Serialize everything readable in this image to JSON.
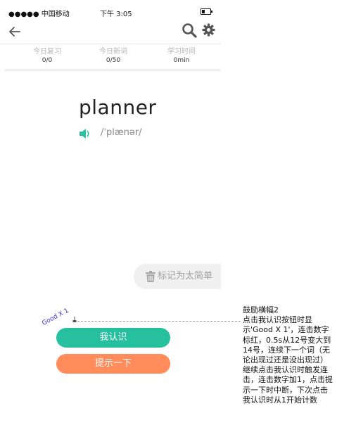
{
  "status_bar": {
    "carrier": "●●●●● 中国移动",
    "time": "下午 3:05"
  },
  "stats": [
    {
      "label": "今日复习",
      "value": "0/0"
    },
    {
      "label": "今日新词",
      "value": "0/50"
    },
    {
      "label": "学习时间",
      "value": "0min"
    }
  ],
  "word_card": {
    "word": "planner",
    "phonetic": "/ˈplænər/"
  },
  "mark_easy": {
    "label": "标记为太简单"
  },
  "combo": {
    "badge": "Good X 1"
  },
  "buttons": {
    "know": "我认识",
    "hint": "提示一下"
  },
  "annotation": {
    "title": "鼓励横幅2",
    "body": "点击我认识按钮时显示'Good X 1'，连击数字标红，0.5s从12号变大到14号，连续下一个词（无论出现过还是没出现过）继续点击我认识时触发连击，连击数字加1，点击提示一下时中断，下次点击我认识时从1开始计数"
  },
  "colors": {
    "know_button": "#26c09f",
    "hint_button": "#ff8c5a",
    "badge_text": "#3b2bd6"
  },
  "icons": [
    "back-arrow-icon",
    "search-icon",
    "gear-icon",
    "speaker-icon",
    "trash-icon",
    "pin-icon",
    "battery-icon"
  ]
}
